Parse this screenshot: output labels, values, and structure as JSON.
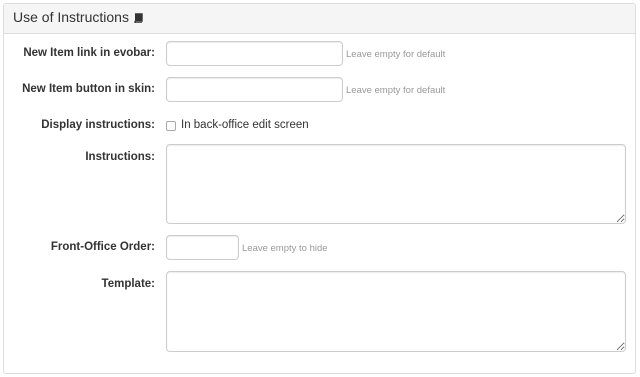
{
  "panel": {
    "title": "Use of Instructions",
    "title_icon": "book-icon"
  },
  "fields": {
    "new_item_link": {
      "label": "New Item link in evobar:",
      "value": "",
      "hint": "Leave empty for default"
    },
    "new_item_button": {
      "label": "New Item button in skin:",
      "value": "",
      "hint": "Leave empty for default"
    },
    "display_instructions": {
      "label": "Display instructions:",
      "checkbox_label": "In back-office edit screen",
      "checked": false
    },
    "instructions": {
      "label": "Instructions:",
      "value": ""
    },
    "front_office_order": {
      "label": "Front-Office Order:",
      "value": "",
      "hint": "Leave empty to hide"
    },
    "template": {
      "label": "Template:",
      "value": ""
    }
  }
}
